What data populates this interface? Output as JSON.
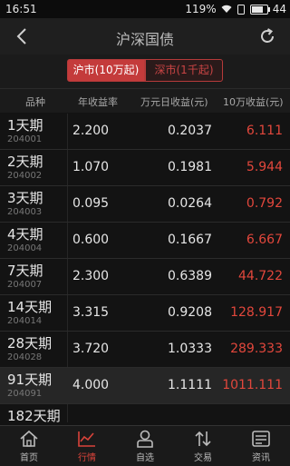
{
  "status": {
    "time": "16:51",
    "battery": "119%",
    "signal_text": "44",
    "battery_level": 0.75
  },
  "header": {
    "title": "沪深国债",
    "back_icon": "arrow-left-icon",
    "refresh_icon": "refresh-icon"
  },
  "market_tabs": [
    {
      "label": "沪市(10万起)",
      "active": true
    },
    {
      "label": "深市(1千起)",
      "active": false
    }
  ],
  "table": {
    "headers": [
      "品种",
      "年收益率",
      "万元日收益(元)",
      "10万收益(元)"
    ],
    "rows": [
      {
        "name": "1天期",
        "code": "204001",
        "rate": "2.200",
        "daily": "0.2037",
        "yield": "6.111"
      },
      {
        "name": "2天期",
        "code": "204002",
        "rate": "1.070",
        "daily": "0.1981",
        "yield": "5.944"
      },
      {
        "name": "3天期",
        "code": "204003",
        "rate": "0.095",
        "daily": "0.0264",
        "yield": "0.792"
      },
      {
        "name": "4天期",
        "code": "204004",
        "rate": "0.600",
        "daily": "0.1667",
        "yield": "6.667"
      },
      {
        "name": "7天期",
        "code": "204007",
        "rate": "2.300",
        "daily": "0.6389",
        "yield": "44.722"
      },
      {
        "name": "14天期",
        "code": "204014",
        "rate": "3.315",
        "daily": "0.9208",
        "yield": "128.917"
      },
      {
        "name": "28天期",
        "code": "204028",
        "rate": "3.720",
        "daily": "1.0333",
        "yield": "289.333"
      },
      {
        "name": "91天期",
        "code": "204091",
        "rate": "4.000",
        "daily": "1.1111",
        "yield": "1011.111"
      },
      {
        "name": "182天期",
        "code": "",
        "rate": "",
        "daily": "",
        "yield": ""
      }
    ]
  },
  "nav": [
    {
      "label": "首页",
      "icon": "home-icon",
      "active": false
    },
    {
      "label": "行情",
      "icon": "chart-icon",
      "active": true
    },
    {
      "label": "自选",
      "icon": "user-icon",
      "active": false
    },
    {
      "label": "交易",
      "icon": "trade-arrows-icon",
      "active": false
    },
    {
      "label": "资讯",
      "icon": "news-icon",
      "active": false
    }
  ],
  "colors": {
    "accent": "#c43b3b",
    "profit": "#e2473c"
  }
}
